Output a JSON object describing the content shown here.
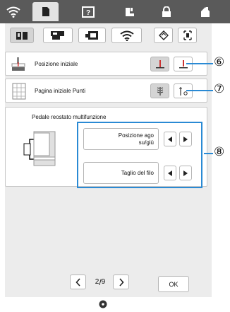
{
  "top_tabs": [
    {
      "icon": "wifi-icon"
    },
    {
      "icon": "document-icon"
    },
    {
      "icon": "help-icon"
    },
    {
      "icon": "sewing-icon"
    },
    {
      "icon": "lock-icon"
    },
    {
      "icon": "home-icon"
    }
  ],
  "sub_tabs": [
    {
      "icon": "book-icon",
      "active": true
    },
    {
      "icon": "machine-icon",
      "active": false
    },
    {
      "icon": "embroidery-icon",
      "active": false
    },
    {
      "icon": "wifi-icon",
      "active": false
    },
    {
      "icon": "diamond-icon",
      "active": false
    },
    {
      "icon": "frame-icon",
      "active": false
    }
  ],
  "settings": {
    "initial_position": {
      "label": "Posizione iniziale",
      "callout": "⑥"
    },
    "stitch_page": {
      "label": "Pagina iniziale Punti",
      "callout": "⑦"
    },
    "pedal": {
      "title": "Pedale reostato multifunzione",
      "callout": "⑧",
      "options": [
        {
          "label_line1": "Posizione ago",
          "label_line2": "su/giù"
        },
        {
          "label_line1": "Taglio del filo",
          "label_line2": ""
        }
      ]
    }
  },
  "pagination": {
    "current": "2",
    "total": "9"
  },
  "ok_label": "OK",
  "colors": {
    "accent": "#2a8ad4",
    "topbar": "#5a5a5a",
    "panel": "#ececec"
  }
}
